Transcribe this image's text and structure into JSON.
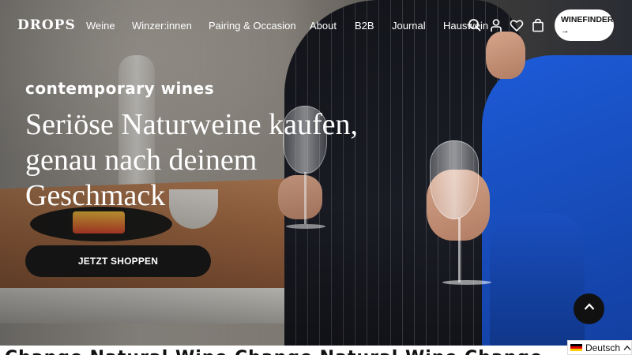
{
  "header": {
    "logo": "DROPS",
    "nav": [
      "Weine",
      "Winzer:innen",
      "Pairing & Occasion",
      "About",
      "B2B",
      "Journal",
      "Hauswein"
    ],
    "icons": [
      "search-icon",
      "account-icon",
      "heart-icon",
      "bag-icon"
    ],
    "winefinder_label": "WINEFINDER",
    "winefinder_arrow": "→"
  },
  "hero": {
    "eyebrow": "contemporary wines",
    "headline": "Seriöse Naturweine kaufen, genau nach deinem Geschmack",
    "cta_label": "JETZT SHOPPEN"
  },
  "marquee": {
    "text": "Change Natural Wine Change Natural Wine Change"
  },
  "language": {
    "selected": "Deutsch",
    "flag_colors": [
      "#000000",
      "#dd0000",
      "#ffce00"
    ]
  },
  "colors": {
    "cta_bg": "#141414",
    "text_on_dark": "#ffffff",
    "shirt_blue": "#1d5bd8"
  }
}
